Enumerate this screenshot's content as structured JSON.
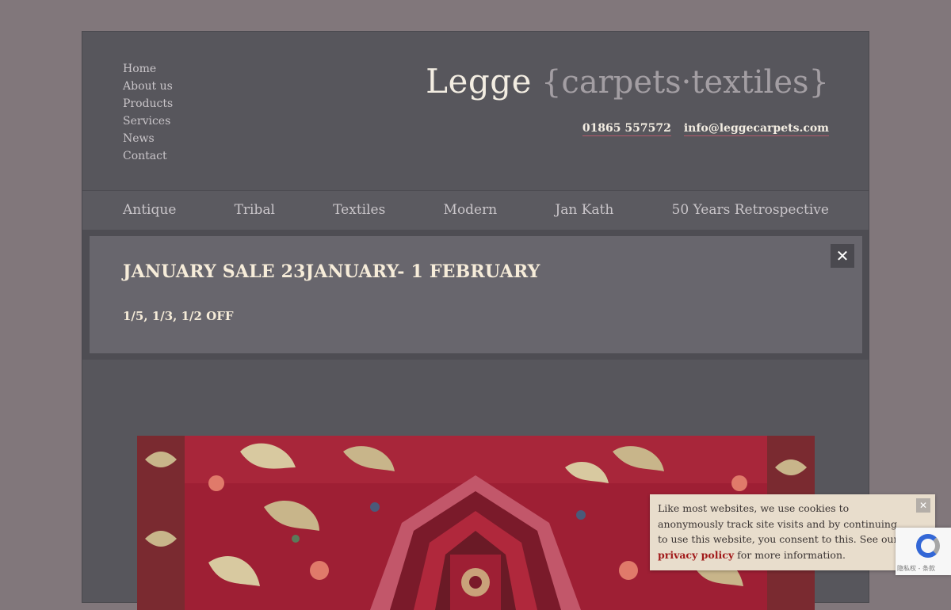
{
  "top_nav": [
    "Home",
    "About us",
    "Products",
    "Services",
    "News",
    "Contact"
  ],
  "brand": {
    "name": "Legge",
    "tagline": "{carpets·textiles}"
  },
  "contacts": {
    "phone": "01865 557572",
    "email": "info@leggecarpets.com"
  },
  "category_nav": [
    "Antique",
    "Tribal",
    "Textiles",
    "Modern",
    "Jan Kath",
    "50 Years Retrospective"
  ],
  "banner": {
    "title": "JANUARY SALE 23JANUARY- 1 FEBRUARY",
    "subtitle": "1/5, 1/3, 1/2 OFF",
    "close_icon": "✕"
  },
  "cookie_notice": {
    "text_before": "Like most websites, we use cookies to anonymously track site visits and by continuing to use this website, you consent to this. See our ",
    "link": "privacy policy",
    "text_after": " for more information.",
    "close_icon": "✕"
  },
  "recaptcha": {
    "text": "隐私权 - 条款"
  },
  "colors": {
    "background": "#81777b",
    "panel": "#57565c",
    "accent_link": "#a11a1a",
    "carpet_red": "#9e1f34"
  }
}
